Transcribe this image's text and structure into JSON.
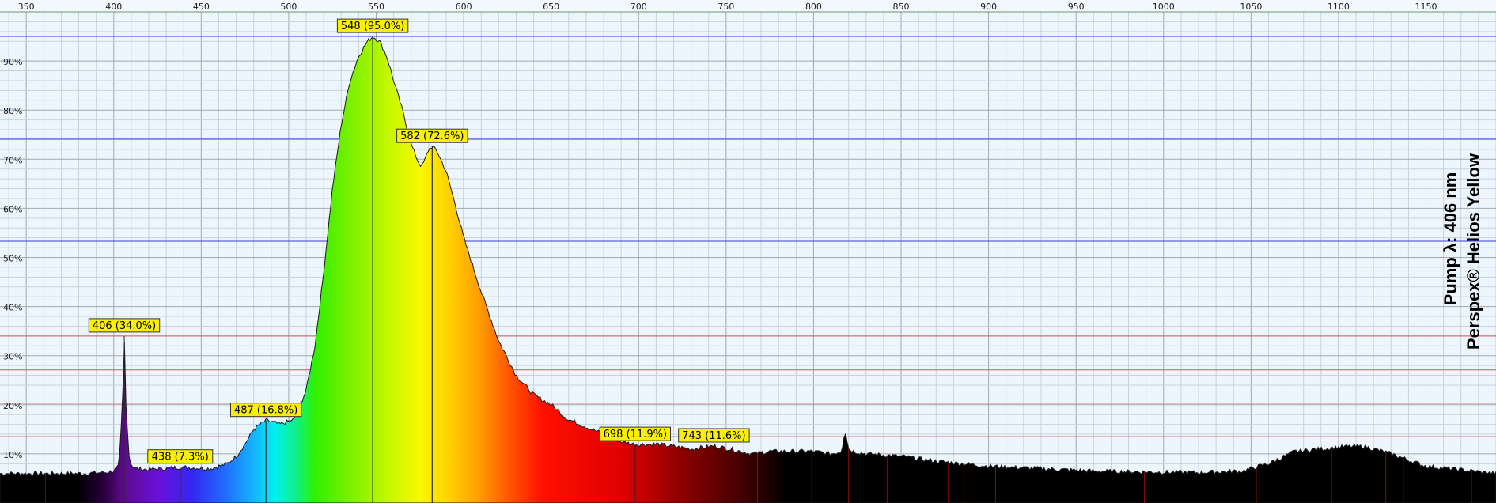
{
  "chart_data": {
    "type": "area",
    "xlim": [
      335,
      1190
    ],
    "ylim": [
      0,
      100
    ],
    "x_ticks": [
      350,
      400,
      450,
      500,
      550,
      600,
      650,
      700,
      750,
      800,
      850,
      900,
      950,
      1000,
      1050,
      1100,
      1150
    ],
    "y_ticks": [
      10,
      20,
      30,
      40,
      50,
      60,
      70,
      80,
      90
    ],
    "y_tick_labels": [
      "10%",
      "20%",
      "30%",
      "40%",
      "50%",
      "60%",
      "70%",
      "80%",
      "90%"
    ],
    "series": [
      {
        "x": [
          335,
          380,
          395,
          400,
          403,
          405,
          406,
          407,
          409,
          412,
          420,
          438,
          455,
          465,
          470,
          475,
          480,
          487,
          495,
          503,
          510,
          515,
          520,
          525,
          530,
          535,
          540,
          545,
          548,
          552,
          556,
          560,
          565,
          570,
          574,
          576,
          578,
          580,
          582,
          585,
          590,
          595,
          600,
          610,
          620,
          630,
          640,
          650,
          660,
          670,
          680,
          690,
          698,
          710,
          720,
          730,
          743,
          755,
          765,
          775,
          785,
          800,
          810,
          816,
          818,
          820,
          823,
          830,
          850,
          870,
          900,
          930,
          960,
          990,
          1020,
          1045,
          1060,
          1075,
          1090,
          1105,
          1115,
          1130,
          1150,
          1190
        ],
        "y": [
          6.0,
          6.0,
          6.2,
          6.5,
          7.5,
          20.0,
          34.0,
          20.0,
          8.5,
          7.0,
          6.8,
          7.3,
          7.0,
          8.0,
          9.5,
          12.0,
          15.0,
          16.8,
          16.0,
          17.0,
          23.0,
          32.0,
          47.0,
          64.0,
          77.0,
          86.0,
          91.0,
          94.0,
          95.0,
          94.0,
          91.0,
          86.0,
          80.0,
          73.0,
          69.5,
          68.5,
          70.0,
          72.0,
          72.6,
          71.5,
          67.5,
          61.0,
          54.0,
          43.0,
          33.0,
          26.0,
          22.0,
          20.0,
          17.0,
          15.5,
          14.0,
          12.5,
          11.9,
          12.0,
          11.5,
          11.0,
          11.6,
          10.8,
          10.0,
          10.5,
          10.5,
          10.5,
          10.0,
          10.5,
          15.0,
          11.0,
          10.5,
          10.0,
          9.5,
          8.5,
          7.5,
          7.0,
          6.5,
          6.3,
          6.2,
          6.5,
          8.0,
          10.5,
          11.0,
          11.5,
          11.5,
          10.0,
          7.5,
          6.0
        ]
      }
    ],
    "peaks": [
      {
        "x": 406,
        "y": 34.0,
        "label": "406 (34.0%)"
      },
      {
        "x": 438,
        "y": 7.3,
        "label": "438 (7.3%)"
      },
      {
        "x": 487,
        "y": 16.8,
        "label": "487 (16.8%)"
      },
      {
        "x": 548,
        "y": 95.0,
        "label": "548 (95.0%)"
      },
      {
        "x": 582,
        "y": 72.6,
        "label": "582 (72.6%)"
      },
      {
        "x": 698,
        "y": 11.9,
        "label": "698 (11.9%)"
      },
      {
        "x": 743,
        "y": 11.6,
        "label": "743 (11.6%)"
      }
    ],
    "reference_lines_y": [
      95.0,
      74.1,
      53.3,
      34.0,
      27.1,
      20.3,
      13.5
    ],
    "marker_lines_x": [
      361,
      438,
      487,
      548,
      582,
      650,
      698,
      743,
      768,
      799,
      820,
      842,
      877,
      886,
      904,
      989,
      1053,
      1096,
      1127,
      1137,
      1176
    ],
    "side_text": [
      "Pump λ: 406 nm",
      "Perspex® Helios Yellow"
    ],
    "colors": {
      "background": "#eef6fd",
      "grid": "#c4d3e0",
      "grid_major": "#a0a8b0",
      "ref_blue": "#3b3bd6",
      "ref_red": "#e05050",
      "label_fill": "#f8f000"
    }
  }
}
